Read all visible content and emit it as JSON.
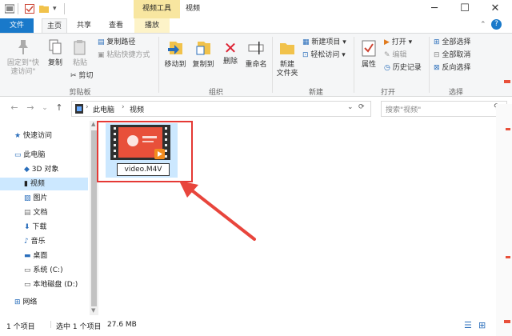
{
  "window": {
    "context_label": "视频工具",
    "title": "视频",
    "minimize": "─",
    "maximize": "☐",
    "close": "✕"
  },
  "tabs": {
    "file": "文件",
    "home": "主页",
    "share": "共享",
    "view": "查看",
    "manage": "播放"
  },
  "ribbon": {
    "clipboard": {
      "pin": "固定到\"快速访问\"",
      "copy": "复制",
      "paste": "粘贴",
      "copy_path": "复制路径",
      "paste_shortcut": "粘贴快捷方式",
      "cut": "剪切",
      "label": "剪贴板"
    },
    "organize": {
      "move_to": "移动到",
      "copy_to": "复制到",
      "delete": "删除",
      "rename": "重命名",
      "label": "组织"
    },
    "new": {
      "new_folder": "新建\n文件夹",
      "new_item": "新建项目 ▾",
      "easy_access": "轻松访问 ▾",
      "label": "新建"
    },
    "open": {
      "properties": "属性",
      "open": "打开 ▾",
      "edit": "编辑",
      "history": "历史记录",
      "label": "打开"
    },
    "select": {
      "select_all": "全部选择",
      "select_none": "全部取消",
      "invert": "反向选择",
      "label": "选择"
    }
  },
  "nav": {
    "back": "←",
    "forward": "→",
    "recent": "⌄",
    "up": "↑",
    "breadcrumb": [
      "此电脑",
      "视频"
    ],
    "search_placeholder": "搜索\"视频\"",
    "refresh": "⟳"
  },
  "sidebar": {
    "items": [
      {
        "label": "快速访问",
        "icon": "star-icon"
      },
      {
        "label": "此电脑",
        "icon": "computer-icon"
      },
      {
        "label": "3D 对象",
        "icon": "cube-icon"
      },
      {
        "label": "视频",
        "icon": "video-icon"
      },
      {
        "label": "图片",
        "icon": "picture-icon"
      },
      {
        "label": "文档",
        "icon": "document-icon"
      },
      {
        "label": "下载",
        "icon": "download-icon"
      },
      {
        "label": "音乐",
        "icon": "music-icon"
      },
      {
        "label": "桌面",
        "icon": "desktop-icon"
      },
      {
        "label": "系统 (C:)",
        "icon": "drive-icon"
      },
      {
        "label": "本地磁盘 (D:)",
        "icon": "drive-icon"
      },
      {
        "label": "网络",
        "icon": "network-icon"
      }
    ]
  },
  "file": {
    "name": "video.M4V"
  },
  "status": {
    "count": "1 个项目",
    "selected": "选中 1 个项目",
    "size": "27.6 MB"
  },
  "colors": {
    "accent": "#1979ca",
    "highlight": "#e53935",
    "arrow": "#e8453c"
  }
}
